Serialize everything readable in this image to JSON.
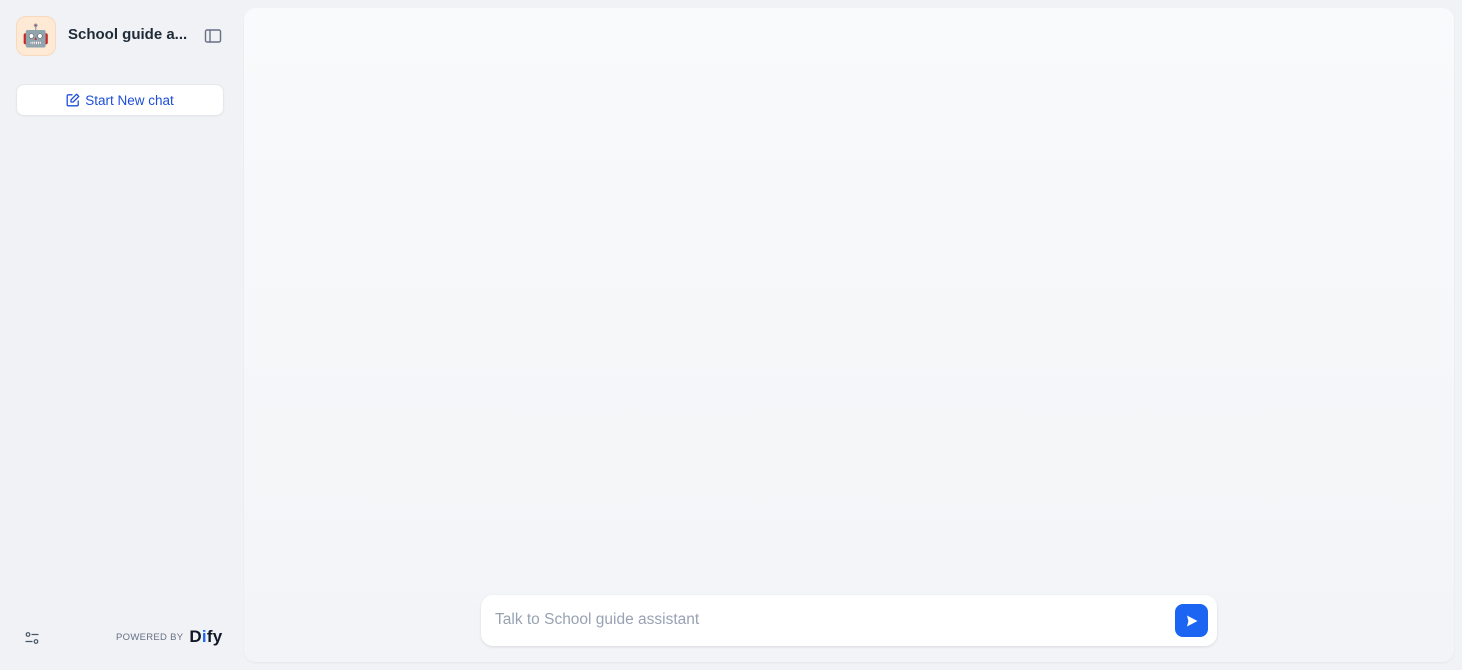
{
  "sidebar": {
    "app_icon": "robot-emoji",
    "app_icon_glyph": "🤖",
    "app_title": "School guide a...",
    "new_chat_label": "Start New chat",
    "powered_by_label": "POWERED BY",
    "brand_name_prefix": "D",
    "brand_name_accent": "i",
    "brand_name_suffix": "fy"
  },
  "chat": {
    "input_placeholder": "Talk to School guide assistant",
    "input_value": ""
  },
  "icons": {
    "sidebar_toggle": "sidebar-toggle-icon",
    "new_chat": "edit-icon",
    "settings": "settings-sliders-icon",
    "send": "send-icon"
  },
  "colors": {
    "accent": "#1c64f2",
    "link_text": "#1d4ed8",
    "app_background": "#f0f2f5",
    "main_panel": "#f9fafb",
    "app_icon_bg": "#fde9d4"
  }
}
